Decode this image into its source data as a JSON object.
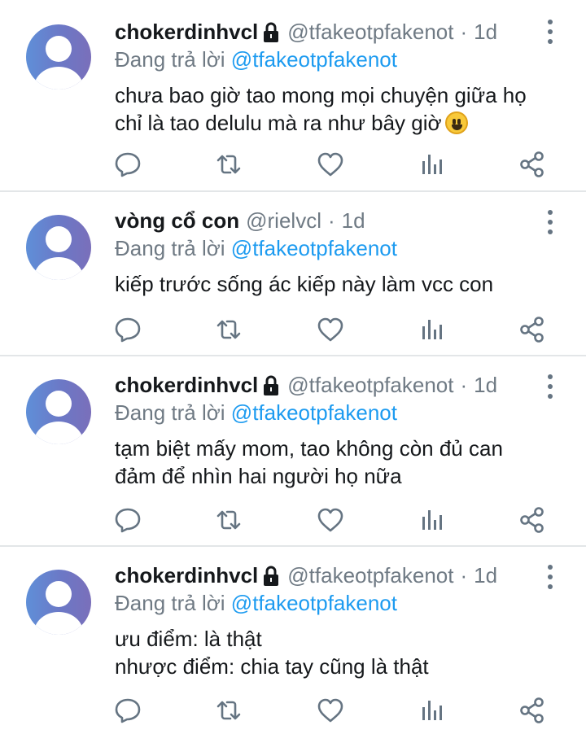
{
  "colors": {
    "link": "#1d9bf0",
    "muted": "#6f7a84",
    "text": "#15181b",
    "icon": "#657482",
    "divider": "#e3e6e8"
  },
  "icons": {
    "reply": "comment-icon",
    "retweet": "retweet-icon",
    "like": "heart-icon",
    "stats": "stats-icon",
    "share": "share-icon",
    "more": "more-vertical-icon",
    "lock": "lock-icon",
    "avatar": "default-avatar"
  },
  "tweets": [
    {
      "display_name": "chokerdinhvcl",
      "locked": true,
      "handle": "@tfakeotpfakenot",
      "separator": "·",
      "time": "1d",
      "reply_prefix": "Đang trả lời",
      "reply_to": "@tfakeotpfakenot",
      "text": "chưa bao giờ tao mong mọi chuyện giữa họ\nchỉ là tao delulu mà ra như bây giờ",
      "emoji": "grinning-face"
    },
    {
      "display_name": "vòng cổ con",
      "locked": false,
      "handle": "@rielvcl",
      "separator": "·",
      "time": "1d",
      "reply_prefix": "Đang trả lời",
      "reply_to": "@tfakeotpfakenot",
      "text": "kiếp trước sống ác kiếp này làm vcc con"
    },
    {
      "display_name": "chokerdinhvcl",
      "locked": true,
      "handle": "@tfakeotpfakenot",
      "separator": "·",
      "time": "1d",
      "reply_prefix": "Đang trả lời",
      "reply_to": "@tfakeotpfakenot",
      "text": "tạm biệt mấy mom, tao không còn đủ can\nđảm để nhìn hai người họ nữa"
    },
    {
      "display_name": "chokerdinhvcl",
      "locked": true,
      "handle": "@tfakeotpfakenot",
      "separator": "·",
      "time": "1d",
      "reply_prefix": "Đang trả lời",
      "reply_to": "@tfakeotpfakenot",
      "text": "ưu điểm: là thật\nnhược điểm: chia tay cũng là thật"
    }
  ]
}
